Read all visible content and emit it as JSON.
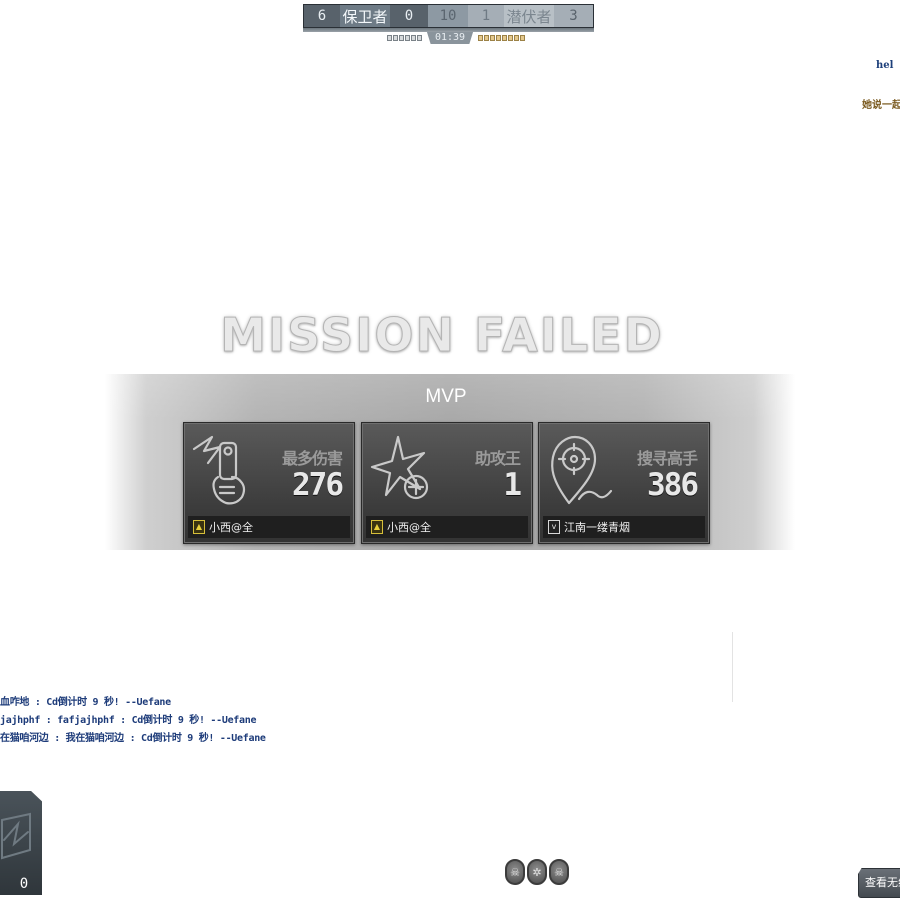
{
  "scoreboard": {
    "left_kills": "6",
    "left_team": "保卫者",
    "left_score": "0",
    "target": "10",
    "right_score": "1",
    "right_team": "潜伏者",
    "right_kills": "3",
    "timer": "01:39"
  },
  "top_right_chat": {
    "line1": "hel",
    "line2": "她说一起"
  },
  "result": {
    "title": "MISSION FAILED",
    "mvp_label": "MVP"
  },
  "mvp_cards": [
    {
      "stat": "最多伤害",
      "value": "276",
      "player": "小西@全",
      "rank_icon": "gold-rank-icon",
      "icon": "pistol-hand-icon"
    },
    {
      "stat": "助攻王",
      "value": "1",
      "player": "小西@全",
      "rank_icon": "gold-rank-icon",
      "icon": "star-plus-icon"
    },
    {
      "stat": "搜寻高手",
      "value": "386",
      "player": "江南一缕青烟",
      "rank_icon": "silver-rank-icon",
      "icon": "location-pin-icon"
    }
  ],
  "chat_log": [
    "血咋地 : Cd倒计时 9 秒! --Uefane",
    "jajhphf : fafjajhphf : Cd倒计时 9 秒! --Uefane",
    "在猫咱河边 : 我在猫咱河边 : Cd倒计时 9 秒! --Uefane"
  ],
  "weapon": {
    "ammo": "0",
    "icon": "weapon-slot-icon"
  },
  "round_icons": [
    "skull-icon",
    "compass-icon",
    "skull-icon"
  ],
  "buttons": {
    "view_label": "查看无线"
  },
  "colors": {
    "chat_text": "#1e3c7a",
    "gold_rank": "#e8cf3b",
    "scoreboard_bg": "#4f5860"
  }
}
